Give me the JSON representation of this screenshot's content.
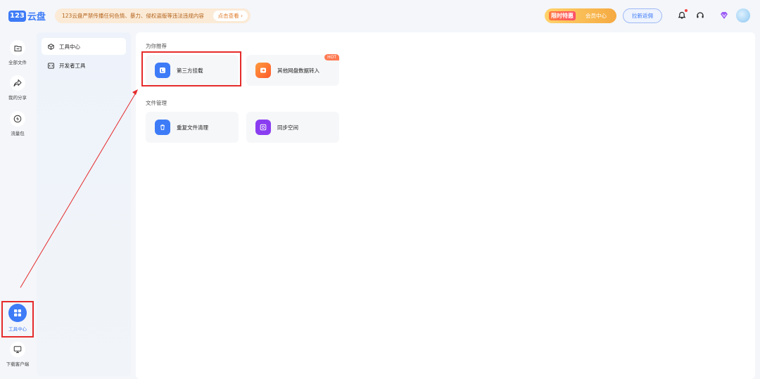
{
  "app": {
    "logo_badge": "123",
    "logo_text": "云盘"
  },
  "topbar": {
    "notice_text": "123云盘严禁传播任何色情、暴力、侵权盗版等违法违规内容",
    "notice_button": "点击查看 ›",
    "promo_tag": "限时特惠",
    "promo_label": "会员中心",
    "invite_button": "拉新返佣"
  },
  "sidebar": {
    "items": [
      {
        "label": "全部文件",
        "icon": "folder-icon"
      },
      {
        "label": "我的分享",
        "icon": "share-icon"
      },
      {
        "label": "流量包",
        "icon": "traffic-icon"
      },
      {
        "label": "工具中心",
        "icon": "grid-icon"
      },
      {
        "label": "下载客户端",
        "icon": "monitor-icon"
      }
    ],
    "active": "工具中心"
  },
  "subsidebar": {
    "items": [
      {
        "label": "工具中心",
        "icon": "cube-icon"
      },
      {
        "label": "开发者工具",
        "icon": "code-icon"
      }
    ]
  },
  "main": {
    "sections": [
      {
        "title": "为你推荐",
        "cards": [
          {
            "label": "第三方挂载",
            "icon": "mount-icon",
            "color": "#3d7bf7"
          },
          {
            "label": "其他网盘数据转入",
            "icon": "import-icon",
            "color": "#ff6a2b",
            "badge": "HOT"
          }
        ]
      },
      {
        "title": "文件管理",
        "cards": [
          {
            "label": "重复文件清理",
            "icon": "trash-icon",
            "color": "#3d7bf7"
          },
          {
            "label": "同步空间",
            "icon": "sync-icon",
            "color": "#8a3df0"
          }
        ]
      }
    ]
  },
  "colors": {
    "accent": "#3d7bf7",
    "highlight": "#e52b2b",
    "hot": "#ff7a52"
  }
}
